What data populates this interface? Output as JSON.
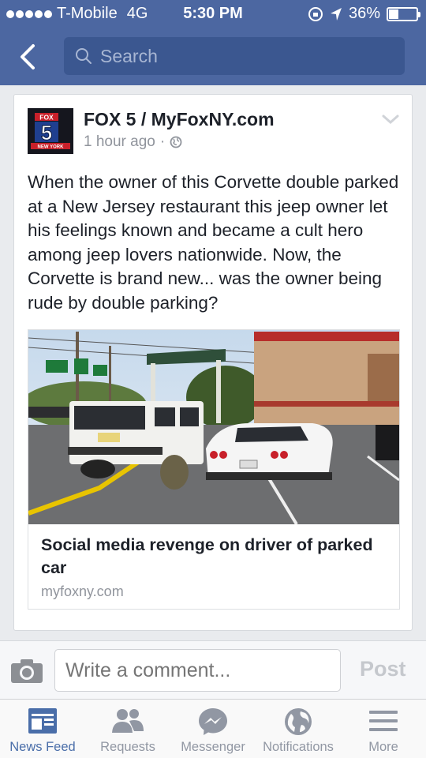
{
  "status_bar": {
    "carrier": "T-Mobile",
    "network": "4G",
    "time": "5:30 PM",
    "battery_percent": "36%",
    "battery_level": 0.36
  },
  "nav": {
    "search_placeholder": "Search"
  },
  "post": {
    "author": "FOX 5 / MyFoxNY.com",
    "timestamp": "1 hour ago",
    "text": "When the owner of this Corvette double parked at a New Jersey restaurant this jeep owner let his feelings known and became a cult hero among jeep lovers nationwide. Now, the Corvette is brand new... was the owner being rude by double parking?",
    "avatar": {
      "top_text": "FOX",
      "number": "5",
      "bottom_text": "NEW YORK"
    },
    "link": {
      "title": "Social media revenge on driver of parked car",
      "domain": "myfoxny.com"
    }
  },
  "comment": {
    "placeholder": "Write a comment...",
    "post_label": "Post"
  },
  "tabs": [
    {
      "label": "News Feed",
      "icon": "news-feed-icon",
      "active": true
    },
    {
      "label": "Requests",
      "icon": "friends-icon",
      "active": false
    },
    {
      "label": "Messenger",
      "icon": "messenger-icon",
      "active": false
    },
    {
      "label": "Notifications",
      "icon": "globe-icon",
      "active": false
    },
    {
      "label": "More",
      "icon": "menu-icon",
      "active": false
    }
  ],
  "colors": {
    "brand_blue": "#4c67a1",
    "active_tab": "#4a6ea9",
    "inactive_tab": "#9197a3"
  }
}
